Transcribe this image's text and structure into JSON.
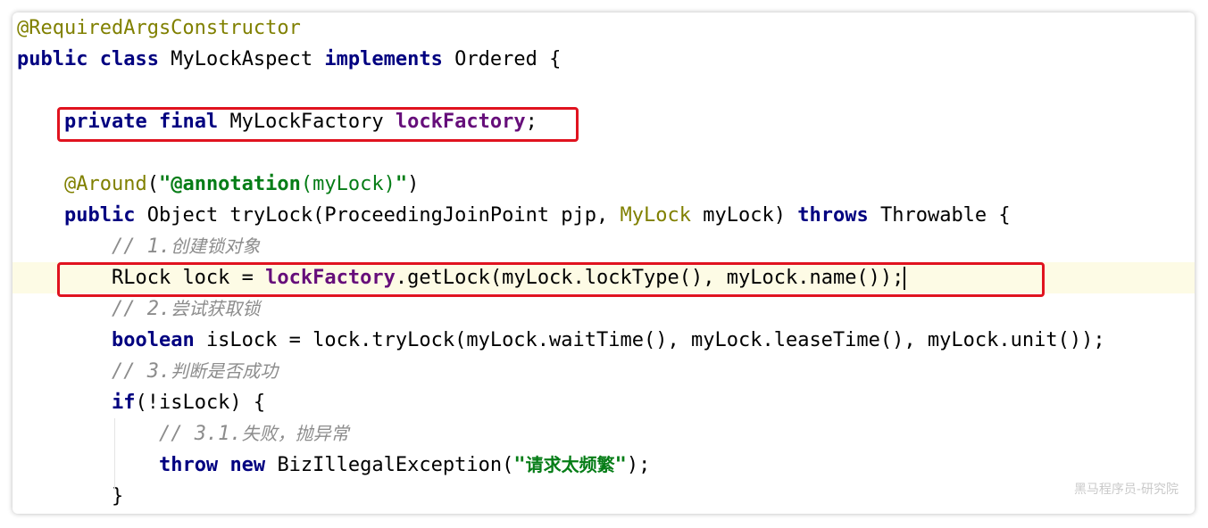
{
  "colors": {
    "keyword": "#000080",
    "annotation": "#808000",
    "string": "#067d17",
    "field": "#660e7a",
    "comment": "#8c8c8c",
    "current_line": "#fdfbe5",
    "highlight_box": "#e0131f"
  },
  "code": {
    "l1": {
      "annotation": "@RequiredArgsConstructor"
    },
    "l2": {
      "kw_public": "public",
      "kw_class": "class",
      "class_name": "MyLockAspect",
      "kw_implements": "implements",
      "iface": "Ordered {"
    },
    "l4": {
      "kw_private": "private",
      "kw_final": "final",
      "type": "MyLockFactory",
      "field": "lockFactory",
      "end": ";"
    },
    "l6": {
      "annotation": "@Around",
      "open": "(",
      "q1": "\"",
      "str_kw": "@annotation",
      "str_rest": "(myLock)",
      "q2": "\"",
      "close": ")"
    },
    "l7": {
      "kw_public": "public",
      "sig1": "Object tryLock(ProceedingJoinPoint pjp,",
      "param_type": "MyLock",
      "sig2": "myLock)",
      "kw_throws": "throws",
      "sig3": "Throwable {"
    },
    "l8": {
      "prefix": "// 1.",
      "cjk": "创建锁对象"
    },
    "l9": {
      "pre": "RLock lock =",
      "field": "lockFactory",
      "post": ".getLock(myLock.lockType(), myLock.name());"
    },
    "l10": {
      "prefix": "// 2.",
      "cjk": "尝试获取锁"
    },
    "l11": {
      "kw_boolean": "boolean",
      "rest": "isLock = lock.tryLock(myLock.waitTime(), myLock.leaseTime(), myLock.unit());"
    },
    "l12": {
      "prefix": "// 3.",
      "cjk": "判断是否成功"
    },
    "l13": {
      "kw_if": "if",
      "rest": "(!isLock) {"
    },
    "l14": {
      "prefix": "// 3.1.",
      "cjk": "失败，抛异常"
    },
    "l15": {
      "kw_throw": "throw",
      "kw_new": "new",
      "ctor": "BizIllegalException(",
      "q1": "\"",
      "str_cjk": "请求太频繁",
      "q2": "\"",
      "end": ");"
    },
    "l16": {
      "brace": "}"
    }
  },
  "watermark": "黑马程序员-研究院"
}
